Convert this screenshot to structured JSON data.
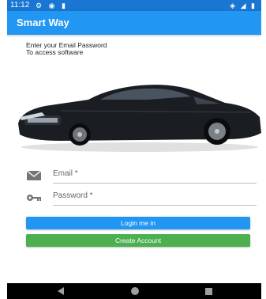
{
  "status_bar": {
    "time": "11:12",
    "left_icons": [
      "settings-icon",
      "at-icon",
      "sd-card-icon"
    ],
    "right_icons": [
      "wifi-icon",
      "signal-icon",
      "battery-icon"
    ]
  },
  "app_bar": {
    "title": "Smart Way"
  },
  "intro": {
    "line1": "Enter your Email Password",
    "line2": "To access software"
  },
  "hero_image": {
    "icon": "car-image"
  },
  "form": {
    "email": {
      "label": "Email *",
      "icon": "mail-icon"
    },
    "password": {
      "label": "Password *",
      "icon": "key-icon"
    }
  },
  "buttons": {
    "login_label": "Login me in",
    "create_label": "Create Account"
  },
  "colors": {
    "primary": "#2196f3",
    "primary_dark": "#1976d2",
    "success": "#4caf50",
    "nav_bar": "#000000"
  },
  "nav_bar": {
    "icons": [
      "back-icon",
      "home-icon",
      "recents-icon"
    ]
  }
}
